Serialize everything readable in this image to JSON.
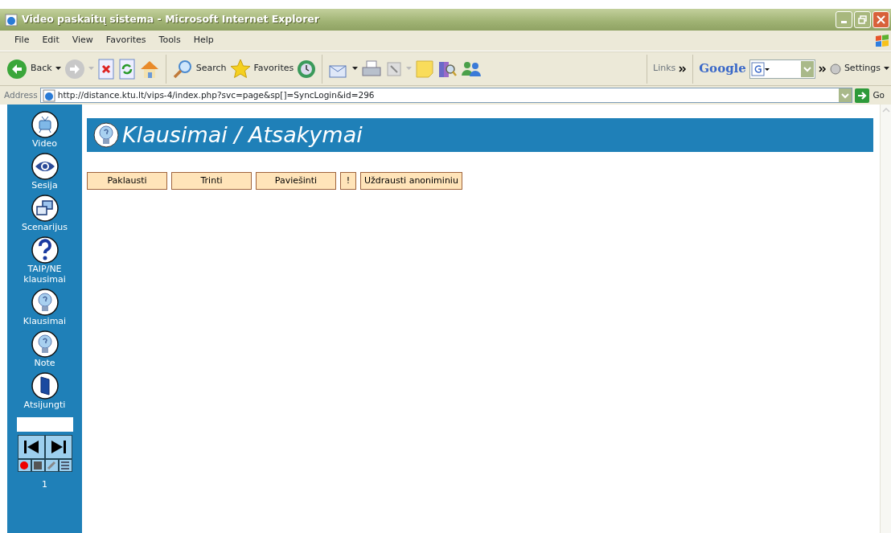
{
  "window": {
    "title": "Video paskaitų sistema - Microsoft Internet Explorer"
  },
  "menu": [
    "File",
    "Edit",
    "View",
    "Favorites",
    "Tools",
    "Help"
  ],
  "toolbar": {
    "back": "Back",
    "search": "Search",
    "favorites": "Favorites",
    "links": "Links",
    "google": "Google",
    "settings": "Settings"
  },
  "address": {
    "label": "Address",
    "url": "http://distance.ktu.lt/vips-4/index.php?svc=page&sp[]=SyncLogin&id=296",
    "go": "Go"
  },
  "sidebar": {
    "items": [
      {
        "label": "Video",
        "kind": "tv"
      },
      {
        "label": "Sesija",
        "kind": "eye"
      },
      {
        "label": "Scenarijus",
        "kind": "windows"
      },
      {
        "label": "TAIP/NE klausimai",
        "kind": "question"
      },
      {
        "label": "Klausimai",
        "kind": "bulb"
      },
      {
        "label": "Note",
        "kind": "bulb"
      },
      {
        "label": "Atsijungti",
        "kind": "door"
      }
    ],
    "page": "1"
  },
  "header": {
    "title": "Klausimai / Atsakymai"
  },
  "buttons": [
    "Paklausti",
    "Trinti",
    "Paviešinti",
    "!",
    "Uždrausti anoniminiu"
  ]
}
